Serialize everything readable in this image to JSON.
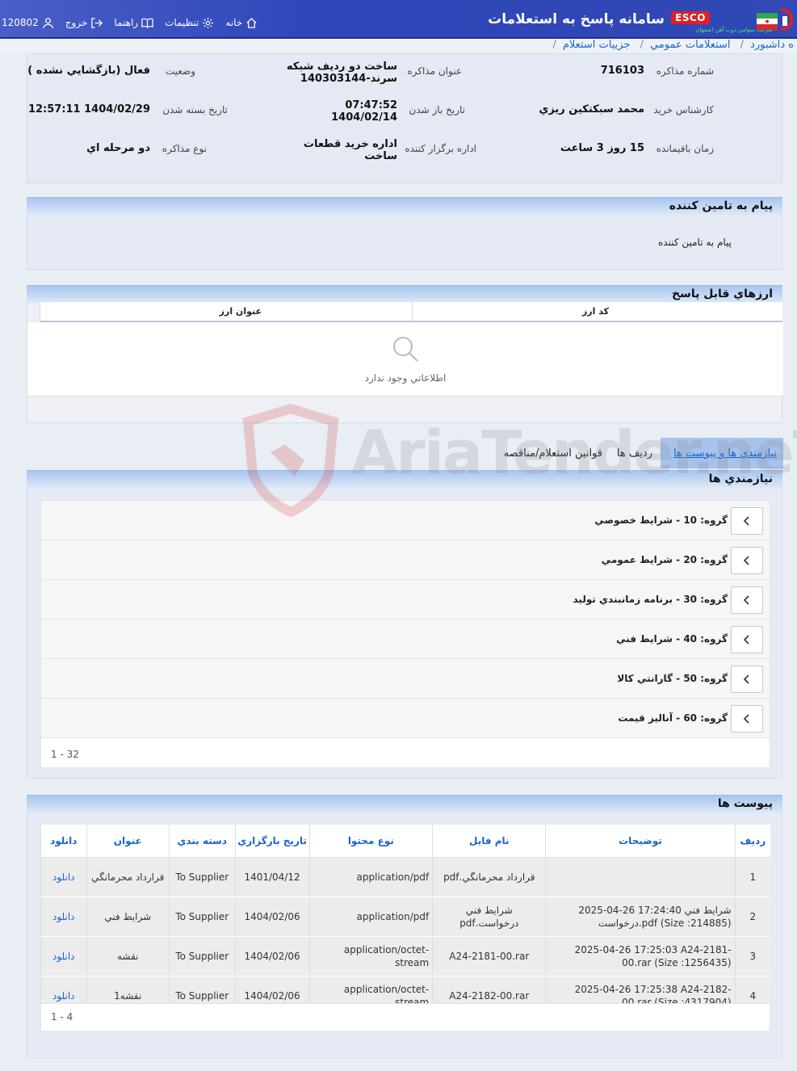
{
  "header": {
    "title": "سامانه پاسخ به استعلامات",
    "esco_badge": "ESCO",
    "esco_subtitle": "شرکت سهامی ذوب آهن اصفهان",
    "nav": {
      "home": "خانه",
      "settings": "تنظيمات",
      "help": "راهنما",
      "logout": "خروج",
      "user_id": "120802"
    }
  },
  "breadcrumb": {
    "items": [
      "ه داشبورد",
      "استعلامات عمومي",
      "جزييات استعلام"
    ]
  },
  "info": {
    "negotiation_number_label": "شماره مذاکره",
    "negotiation_number": "716103",
    "subject_label": "عنوان مذاکره",
    "subject_line1": "ساخت دو رديف شبکه",
    "subject_line2": "سرند-140303144",
    "status_label": "وضعيت",
    "status": "فعال (بازگشايي نشده )",
    "buyer_label": "کارشناس خريد",
    "buyer": "محمد سبکتکين ريزي",
    "open_date_label": "تاريخ باز شدن",
    "open_time": "07:47:52",
    "open_date": "1404/02/14",
    "close_date_label": "تاريخ بسته شدن",
    "close_date": "1404/02/29 12:57:11",
    "remaining_label": "زمان باقيمانده",
    "remaining": "15 روز 3 ساعت",
    "organizer_label": "اداره برگزار کننده",
    "organizer_line1": "اداره خريد قطعات",
    "organizer_line2": "ساخت",
    "type_label": "نوع مذاکره",
    "type": "دو مرحله اي"
  },
  "supplier_message": {
    "title": "پيام به تامين کننده",
    "body": "پيام به تامين کننده"
  },
  "currencies": {
    "title": "ارزهاي قابل پاسخ",
    "col_code": "کد ارز",
    "col_title": "عنوان ارز",
    "empty": "اطلاعاتي وجود ندارد"
  },
  "tabs": [
    "نيازمندي ها و پيوست ها",
    "رديف ها",
    "قوانين استعلام/مناقصه"
  ],
  "requirements": {
    "title": "نيازمندي ها",
    "groups": [
      "گروه: 10 - شرايط خصوصي",
      "گروه: 20 - شرايط عمومي",
      "گروه: 30 - برنامه زمانبندي توليد",
      "گروه: 40 - شرايط فني",
      "گروه: 50 - گارانتي کالا",
      "گروه: 60 - آناليز قيمت"
    ],
    "pager": "1 - 32"
  },
  "attachments": {
    "title": "پيوست ها",
    "headers": [
      "رديف",
      "توضيحات",
      "نام فايل",
      "نوع محتوا",
      "تاريخ بارگزاري",
      "دسته بندي",
      "عنوان",
      "دانلود"
    ],
    "rows": [
      {
        "n": "1",
        "desc": "",
        "file": "قرارداد محرمانگي.pdf",
        "type": "application/pdf",
        "date": "1401/04/12",
        "cat": "To Supplier",
        "title": "قرارداد محرمانگي",
        "dl": "دانلود"
      },
      {
        "n": "2",
        "desc": "2025-04-26 17:24:40 شرايط فني درخواست.pdf (Size :214885)",
        "file": "شرايط فني درخواست.pdf",
        "type": "application/pdf",
        "date": "1404/02/06",
        "cat": "To Supplier",
        "title": "شرايط فني",
        "dl": "دانلود"
      },
      {
        "n": "3",
        "desc": "2025-04-26 17:25:03 A24-2181-00.rar (Size :1256435)",
        "file": "A24-2181-00.rar",
        "type": "application/octet-stream",
        "date": "1404/02/06",
        "cat": "To Supplier",
        "title": "نقشه",
        "dl": "دانلود"
      },
      {
        "n": "4",
        "desc": "2025-04-26 17:25:38 A24-2182-00.rar (Size :4317904)",
        "file": "A24-2182-00.rar",
        "type": "application/octet-stream",
        "date": "1404/02/06",
        "cat": "To Supplier",
        "title": "نقشه1",
        "dl": "دانلود"
      }
    ],
    "pager": "1 - 4"
  },
  "watermark": "AriaTender.neT"
}
